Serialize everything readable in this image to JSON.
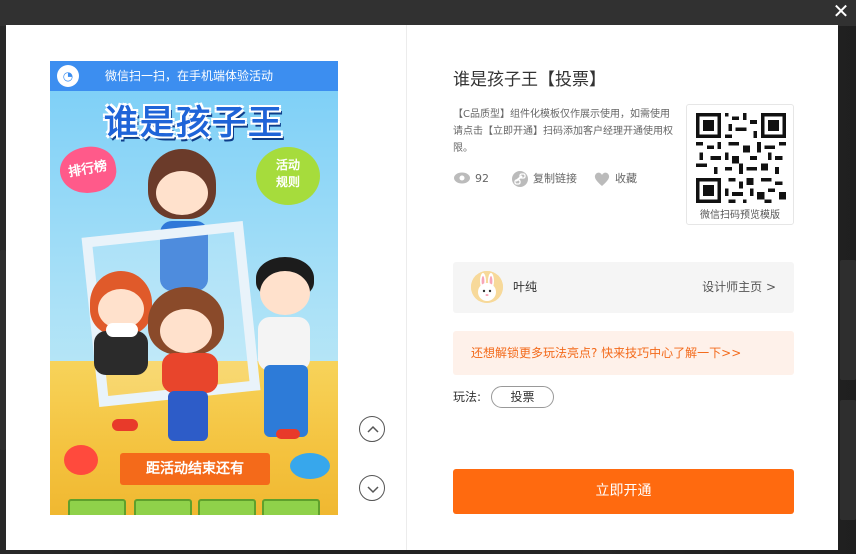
{
  "window": {
    "close_label": "✕"
  },
  "preview": {
    "wechat_bar": "微信扫一扫，在手机端体验活动",
    "game_title": "谁是孩子王",
    "rank_badge": "排行榜",
    "rule_badge_line1": "活动",
    "rule_badge_line2": "规则",
    "countdown_text": "距活动结束还有"
  },
  "template": {
    "title": "谁是孩子王【投票】",
    "description": "【C品质型】组件化模板仅作展示使用，如需使用请点击【立即开通】扫码添加客户经理开通使用权限。",
    "views": "92",
    "copy_link": "复制链接",
    "favorite": "收藏",
    "qr_label": "微信扫码预览模版"
  },
  "designer": {
    "name": "叶纯",
    "home_link": "设计师主页 >"
  },
  "tip": {
    "text": "还想解锁更多玩法亮点? 快来技巧中心了解一下>>"
  },
  "play": {
    "label": "玩法:",
    "tag": "投票"
  },
  "actions": {
    "open_button": "立即开通"
  },
  "colors": {
    "accent": "#ff6a0f",
    "tip_text": "#f36a1b",
    "tip_bg": "#fef1ea",
    "preview_bar": "#3c8ef0"
  }
}
